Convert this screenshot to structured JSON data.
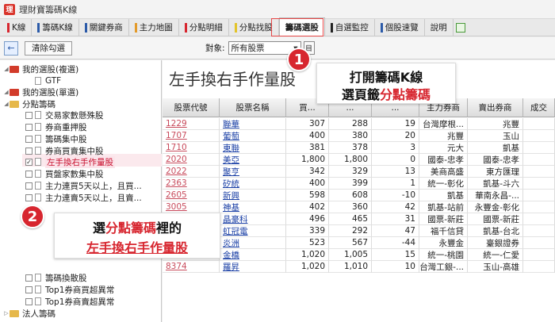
{
  "app": {
    "title": "理財寶籌碼K線",
    "logo_letter": "理"
  },
  "tabs": [
    {
      "label": "K線",
      "mark": "#d7262f"
    },
    {
      "label": "籌碼K線",
      "mark": "#2b5aa8"
    },
    {
      "label": "關鍵券商",
      "mark": "#2b5aa8"
    },
    {
      "label": "主力地圖",
      "mark": "#e39a2a"
    },
    {
      "label": "分點明細",
      "mark": "#d7262f"
    },
    {
      "label": "分點找股",
      "mark": "#e3c42a"
    },
    {
      "label": "籌碼選股",
      "mark": "",
      "active": true
    },
    {
      "label": "自選監控",
      "mark": "#222"
    },
    {
      "label": "個股速覽",
      "mark": "#2b5aa8"
    },
    {
      "label": "說明",
      "mark": ""
    }
  ],
  "toolbar": {
    "back_icon": "←",
    "clear_label": "清除勾選",
    "target_label": "對象:",
    "target_value": "所有股票",
    "target_btn": "目"
  },
  "sidebar": {
    "items": [
      {
        "label": "我的選股(複選)",
        "kind": "folder-red",
        "level": 0
      },
      {
        "label": "GTF",
        "kind": "doc",
        "level": 1
      },
      {
        "label": "我的選股(單選)",
        "kind": "folder-red",
        "level": 0
      },
      {
        "label": "分點籌碼",
        "kind": "folder-yel",
        "level": 0
      },
      {
        "label": "交易家數懸殊股",
        "kind": "check",
        "level": 1
      },
      {
        "label": "券商重押股",
        "kind": "check",
        "level": 1
      },
      {
        "label": "籌碼集中股",
        "kind": "check",
        "level": 1
      },
      {
        "label": "券商買賣集中股",
        "kind": "check",
        "level": 1
      },
      {
        "label": "左手換右手作量股",
        "kind": "check",
        "level": 1,
        "checked": true,
        "selected": true
      },
      {
        "label": "買盤家數集中股",
        "kind": "check",
        "level": 1
      },
      {
        "label": "主力連買5天以上，且買...",
        "kind": "check",
        "level": 1
      },
      {
        "label": "主力連賣5天以上，且賣...",
        "kind": "check",
        "level": 1
      },
      {
        "label": "籌碼換散股",
        "kind": "check",
        "level": 1
      },
      {
        "label": "Top1券商買超異常",
        "kind": "check",
        "level": 1
      },
      {
        "label": "Top1券商賣超異常",
        "kind": "check",
        "level": 1
      },
      {
        "label": "法人籌碼",
        "kind": "folder-yel",
        "level": 0
      }
    ]
  },
  "main": {
    "title": "左手換右手作量股",
    "columns": [
      "股票代號",
      "股票名稱",
      "買...",
      "...",
      "...",
      "主力券商",
      "賣出券商",
      "成交"
    ],
    "rows": [
      [
        "1229",
        "聯華",
        "307",
        "288",
        "19",
        "台灣摩根...",
        "兆豐",
        ""
      ],
      [
        "1707",
        "葡萄",
        "400",
        "380",
        "20",
        "兆豐",
        "玉山",
        ""
      ],
      [
        "1710",
        "東聯",
        "381",
        "378",
        "3",
        "元大",
        "凱基",
        ""
      ],
      [
        "2020",
        "美亞",
        "1,800",
        "1,800",
        "0",
        "國泰-忠孝",
        "國泰-忠孝",
        ""
      ],
      [
        "2022",
        "聚亨",
        "342",
        "329",
        "13",
        "美商高盛",
        "東方匯理",
        ""
      ],
      [
        "2363",
        "矽統",
        "400",
        "399",
        "1",
        "統一-彰化",
        "凱基-斗六",
        ""
      ],
      [
        "2605",
        "新興",
        "598",
        "608",
        "-10",
        "凱基",
        "華南永昌-...",
        ""
      ],
      [
        "3005",
        "神基",
        "402",
        "360",
        "42",
        "凱基-站前",
        "永豐金-彰化",
        ""
      ],
      [
        "3006",
        "晶豪科",
        "496",
        "465",
        "31",
        "國票-新莊",
        "國票-新莊",
        ""
      ],
      [
        "3257",
        "虹冠電",
        "339",
        "292",
        "47",
        "福千信貸",
        "凱基-台北",
        ""
      ],
      [
        "4306",
        "炎洲",
        "523",
        "567",
        "-44",
        "永豐金",
        "臺銀證券",
        ""
      ],
      [
        "6133",
        "金橋",
        "1,020",
        "1,005",
        "15",
        "統一-桃園",
        "統一-仁愛",
        ""
      ],
      [
        "8374",
        "羅昇",
        "1,020",
        "1,010",
        "10",
        "台灣工銀-...",
        "玉山-高雄",
        ""
      ]
    ]
  },
  "callout1": {
    "badge": "1",
    "line1": "打開籌碼K線",
    "line2_prefix": "選頁籤",
    "line2_red": "分點籌碼"
  },
  "callout2": {
    "badge": "2",
    "line1_prefix": "選",
    "line1_red": "分點籌碼",
    "line1_suffix": "裡的",
    "line2_red": "左手換右手作量股"
  }
}
